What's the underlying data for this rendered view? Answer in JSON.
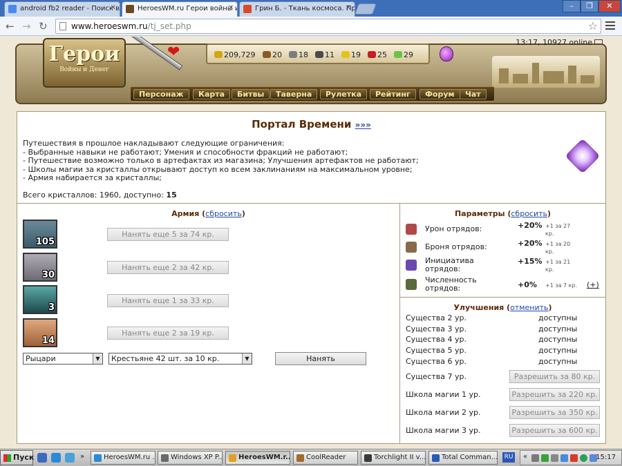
{
  "browser": {
    "tabs": [
      {
        "title": "android fb2 reader - Поиск в",
        "active": false
      },
      {
        "title": "HeroesWM.ru Герои войны и",
        "active": true
      },
      {
        "title": "Грин Б. - Ткань космоса. Пр",
        "active": false
      }
    ],
    "url_host": "www.heroeswm.ru",
    "url_path": "/tj_set.php",
    "window_controls": [
      "–",
      "❐",
      "✕"
    ]
  },
  "game_header": {
    "logo_title": "Герои",
    "logo_subtitle": "Войны и Денег",
    "status": "13:17, 10927 online",
    "resources": [
      {
        "icon": "gold-icon",
        "value": "209,729",
        "color": "#d4a412"
      },
      {
        "icon": "wood-icon",
        "value": "20",
        "color": "#8a5a2a"
      },
      {
        "icon": "ore-icon",
        "value": "18",
        "color": "#7d7d7d"
      },
      {
        "icon": "mercury-icon",
        "value": "11",
        "color": "#4a4a4a"
      },
      {
        "icon": "sulfur-icon",
        "value": "19",
        "color": "#e3c21a"
      },
      {
        "icon": "crystal-icon",
        "value": "25",
        "color": "#c42020"
      },
      {
        "icon": "gems-icon",
        "value": "29",
        "color": "#6bc24a"
      }
    ],
    "nav": [
      "Персонаж",
      "Карта",
      "Битвы",
      "Таверна",
      "Рулетка",
      "Рейтинг",
      "Форум",
      "Чат"
    ]
  },
  "portal": {
    "title": "Портал Времени",
    "link": "»»»",
    "restrictions": [
      "Путешествия в прошлое накладывают следующие ограничения:",
      "- Выбранные навыки не работают; Умения и способности фракций не работают;",
      "- Путешествие возможно только в артефактах из магазина; Улучшения артефактов не работают;",
      "- Школы магии за кристаллы открывают доступ ко всем заклинаниям на максимальном уровне;",
      "- Армия набирается за кристаллы;"
    ],
    "crystals_label": "Всего кристаллов: 1960, доступно: ",
    "crystals_available": "15"
  },
  "army": {
    "title": "Армия",
    "reset": "сбросить",
    "units": [
      {
        "count": "105",
        "hire": "Нанять еще 5 за 74 кр.",
        "color": "#3d5a6a"
      },
      {
        "count": "30",
        "hire": "Нанять еще 2 за 42 кр.",
        "color": "#6d6a74"
      },
      {
        "count": "3",
        "hire": "Нанять еще 1 за 33 кр.",
        "color": "#2e6a6a"
      },
      {
        "count": "14",
        "hire": "Нанять еще 2 за 19 кр.",
        "color": "#a0623a"
      }
    ],
    "faction_select": "Рыцари",
    "unit_select": "Крестьяне 42 шт. за 10 кр.",
    "hire_button": "Нанять"
  },
  "params": {
    "title": "Параметры",
    "reset": "сбросить",
    "rows": [
      {
        "icon": "sword-icon",
        "label": "Урон отрядов:",
        "value": "+20%",
        "cost": "+1 за 27 кр.",
        "plus": ""
      },
      {
        "icon": "armor-icon",
        "label": "Броня отрядов:",
        "value": "+20%",
        "cost": "+1 за 20 кр.",
        "plus": ""
      },
      {
        "icon": "initiative-icon",
        "label": "Инициатива отрядов:",
        "value": "+15%",
        "cost": "+1 за 21 кр.",
        "plus": ""
      },
      {
        "icon": "troops-icon",
        "label": "Численность отрядов:",
        "value": "+0%",
        "cost": "+1 за 7 кр.",
        "plus": "(+)"
      }
    ]
  },
  "upgrades": {
    "title": "Улучшения",
    "cancel": "отменить",
    "rows": [
      {
        "label": "Существа 2 ур.",
        "status": "доступны"
      },
      {
        "label": "Существа 3 ур.",
        "status": "доступны"
      },
      {
        "label": "Существа 4 ур.",
        "status": "доступны"
      },
      {
        "label": "Существа 5 ур.",
        "status": "доступны"
      },
      {
        "label": "Существа 6 ур.",
        "status": "доступны"
      },
      {
        "label": "Существа 7 ур.",
        "button": "Разрешить за 80 кр."
      },
      {
        "label": "Школа магии 1 ур.",
        "button": "Разрешить за 220 кр."
      },
      {
        "label": "Школа магии 2 ур.",
        "button": "Разрешить за 350 кр."
      },
      {
        "label": "Школа магии 3 ур.",
        "button": "Разрешить за 600 кр."
      }
    ]
  },
  "taskbar": {
    "start": "Пуск",
    "items": [
      {
        "label": "HeroesWM.ru ...",
        "active": false
      },
      {
        "label": "Windows XP P...",
        "active": false
      },
      {
        "label": "HeroesWM.r...",
        "active": true
      },
      {
        "label": "CoolReader",
        "active": false
      },
      {
        "label": "Torchlight II v...",
        "active": false
      },
      {
        "label": "Total Comman...",
        "active": false
      }
    ],
    "lang": "RU",
    "clock": "15:17"
  }
}
